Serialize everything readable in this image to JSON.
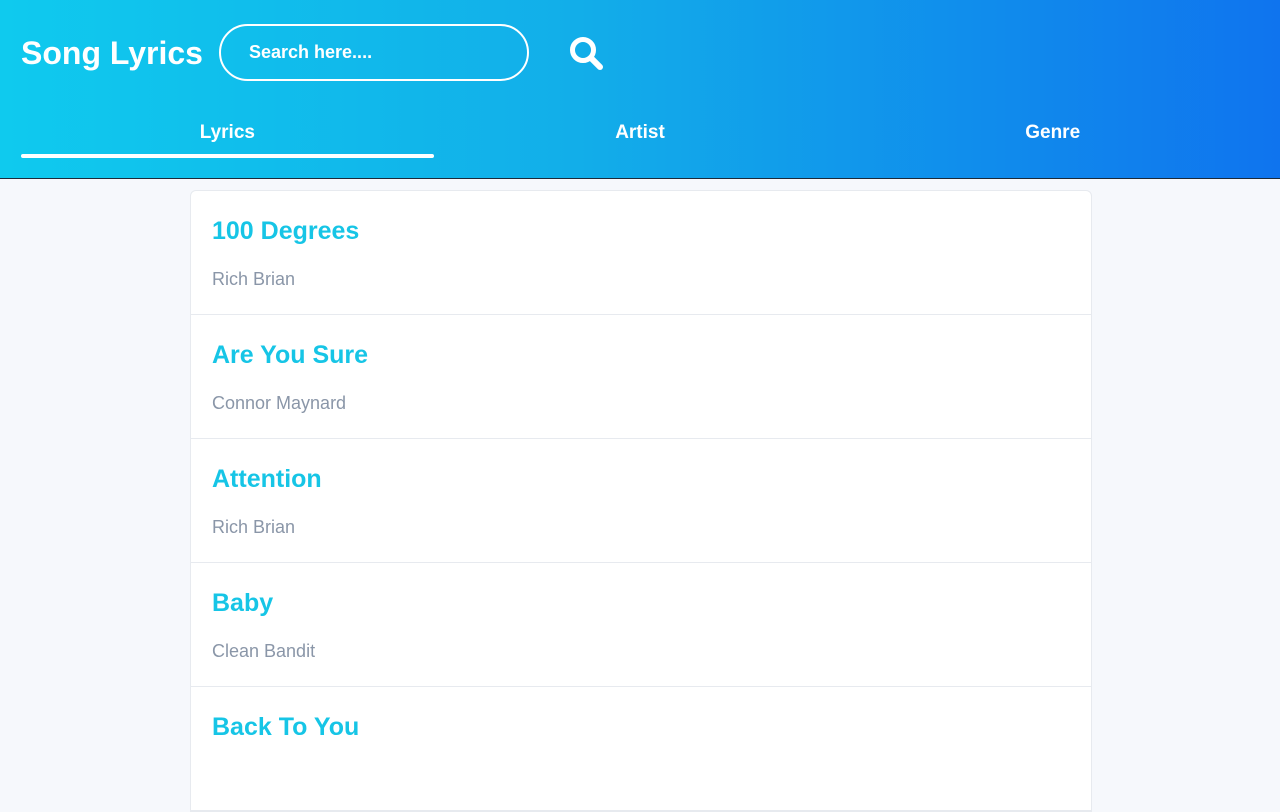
{
  "header": {
    "app_title": "Song Lyrics",
    "search": {
      "placeholder": "Search here....",
      "value": ""
    },
    "search_icon": "search-icon"
  },
  "tabs": [
    {
      "label": "Lyrics",
      "active": true
    },
    {
      "label": "Artist",
      "active": false
    },
    {
      "label": "Genre",
      "active": false
    }
  ],
  "songs": [
    {
      "title": "100 Degrees",
      "artist": "Rich Brian"
    },
    {
      "title": "Are You Sure",
      "artist": "Connor Maynard"
    },
    {
      "title": "Attention",
      "artist": "Rich Brian"
    },
    {
      "title": "Baby",
      "artist": "Clean Bandit"
    },
    {
      "title": "Back To You",
      "artist": ""
    }
  ],
  "colors": {
    "header_gradient_start": "#0fcaee",
    "header_gradient_end": "#0f74ee",
    "song_title": "#16c5e6",
    "artist_text": "#8a96a8",
    "page_background": "#f6f8fc"
  }
}
